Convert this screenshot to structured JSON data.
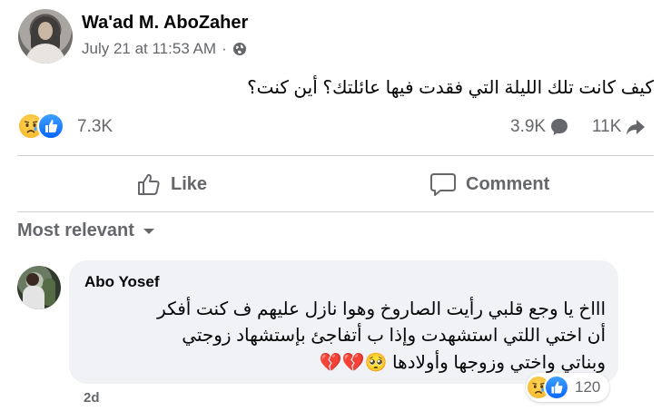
{
  "post": {
    "author_name": "Wa'ad M. AboZaher",
    "timestamp": "July 21 at 11:53 AM",
    "meta_separator": "·",
    "audience_icon": "globe-icon",
    "text": "كيف كانت تلك الليلة التي فقدت فيها عائلتك؟ أين كنت؟"
  },
  "stats": {
    "reaction_icons": [
      "sad-reaction-icon",
      "like-reaction-icon"
    ],
    "reactions": "7.3K",
    "comments": "3.9K",
    "shares": "11K"
  },
  "actions": {
    "like_label": "Like",
    "comment_label": "Comment"
  },
  "comments_section": {
    "sort_label": "Most relevant"
  },
  "comment": {
    "author_name": "Abo Yosef",
    "text_line1": "اااخ يا وجع قلبي رأيت الصاروخ وهوا نازل عليهم ف كنت أفكر",
    "text_line2": "أن اختي اللتي استشهدت وإذا ب أتفاجئ بإستشهاد زوجتي",
    "text_line3": "وبناتي واختي وزوجها وأولادها",
    "text_emoji": "🥺💔💔",
    "reaction_count": "120",
    "time": "2d"
  },
  "colors": {
    "secondary_text": "#65676b",
    "bubble_bg": "#f0f2f5",
    "like_blue": "#0866ff",
    "divider": "#ced0d4"
  }
}
